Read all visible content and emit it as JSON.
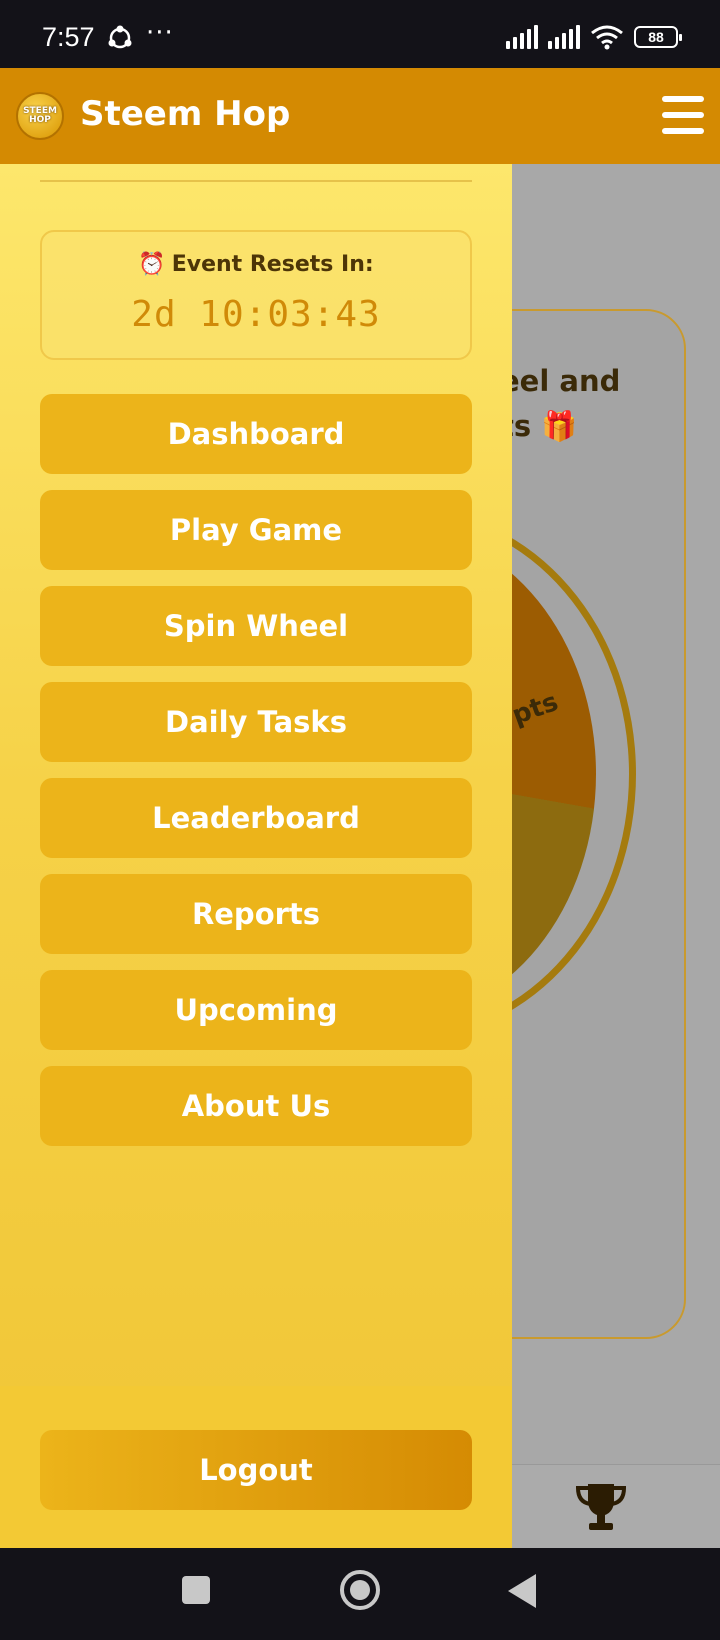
{
  "status_bar": {
    "time": "7:57",
    "dots": "···",
    "battery": "88",
    "icons": [
      "sync-icon",
      "signal-icon",
      "signal-icon",
      "wifi-icon",
      "battery-icon"
    ]
  },
  "header": {
    "logo_text": "STEEM HOP",
    "title": "Steem Hop",
    "menu_icon": "hamburger-icon"
  },
  "drawer": {
    "timer": {
      "label": "Event Resets In:",
      "icon": "alarm-clock-icon",
      "value": "2d 10:03:43"
    },
    "items": [
      {
        "label": "Dashboard"
      },
      {
        "label": "Play Game"
      },
      {
        "label": "Spin Wheel"
      },
      {
        "label": "Daily Tasks"
      },
      {
        "label": "Leaderboard"
      },
      {
        "label": "Reports"
      },
      {
        "label": "Upcoming"
      },
      {
        "label": "About Us"
      }
    ],
    "logout_label": "Logout"
  },
  "background": {
    "card_text_line1": "eel and",
    "card_text_line2": "ts 🎁",
    "wheel_label": "pts",
    "bottom_nav_icon": "trophy-icon"
  },
  "colors": {
    "header": "#d48a02",
    "button": "#ecb41a",
    "drawer_top": "#fde76c",
    "timer_text": "#d08a08"
  }
}
